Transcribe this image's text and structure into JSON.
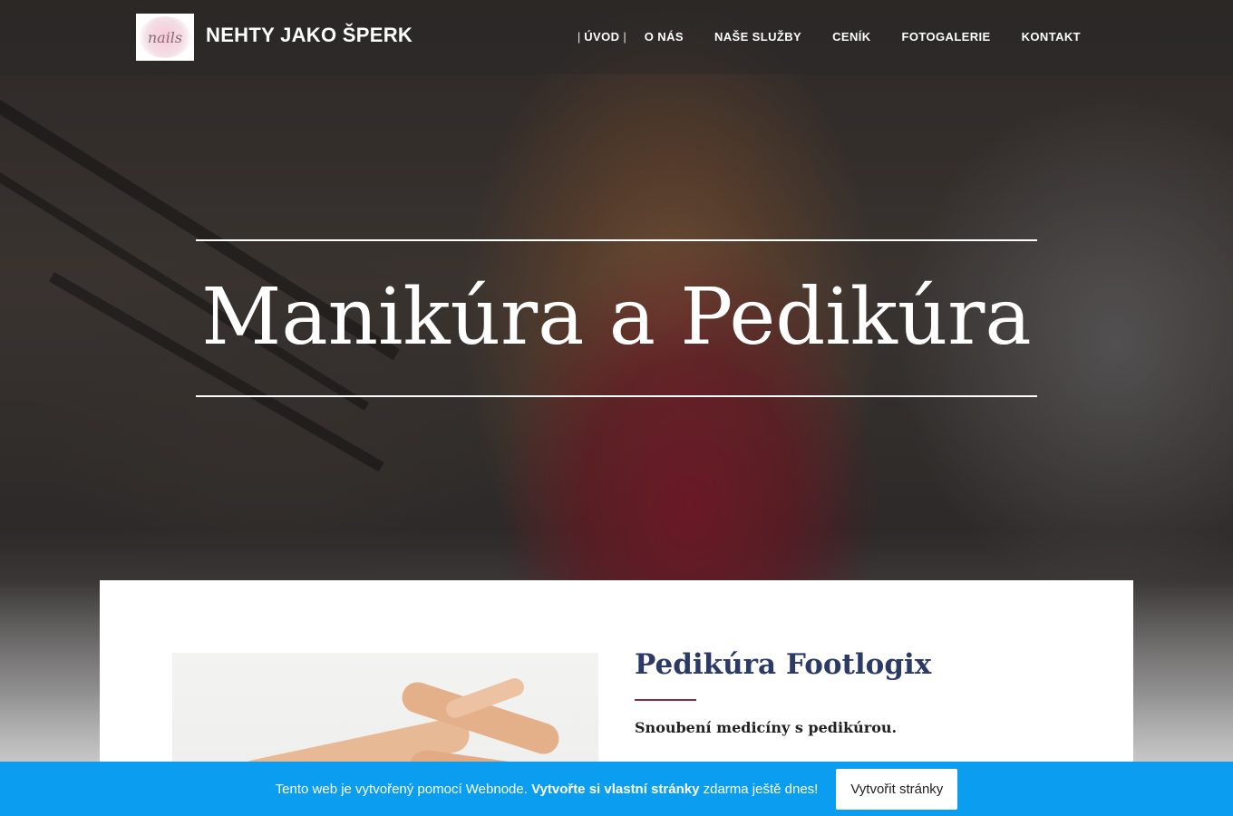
{
  "brand": {
    "logo_text": "nails",
    "title": "NEHTY JAKO ŠPERK"
  },
  "nav": {
    "items": [
      {
        "label": "ÚVOD",
        "active": true
      },
      {
        "label": "O NÁS"
      },
      {
        "label": "NAŠE SLUŽBY"
      },
      {
        "label": "CENÍK"
      },
      {
        "label": "FOTOGALERIE"
      },
      {
        "label": "KONTAKT"
      }
    ],
    "separator": "|"
  },
  "hero": {
    "title": "Manikúra a Pedikúra"
  },
  "article": {
    "heading": "Pedikúra Footlogix",
    "subheading": "Snoubení medicíny s pedikúrou.",
    "accent_color": "#8b2a45",
    "heading_color": "#2c3a67"
  },
  "promo_bar": {
    "text_before": "Tento web je vytvořený pomocí Webnode.",
    "text_bold": "Vytvořte si vlastní stránky",
    "text_after": "zdarma ještě dnes!",
    "button_label": "Vytvořit stránky",
    "background_color": "#0b9ef0"
  }
}
